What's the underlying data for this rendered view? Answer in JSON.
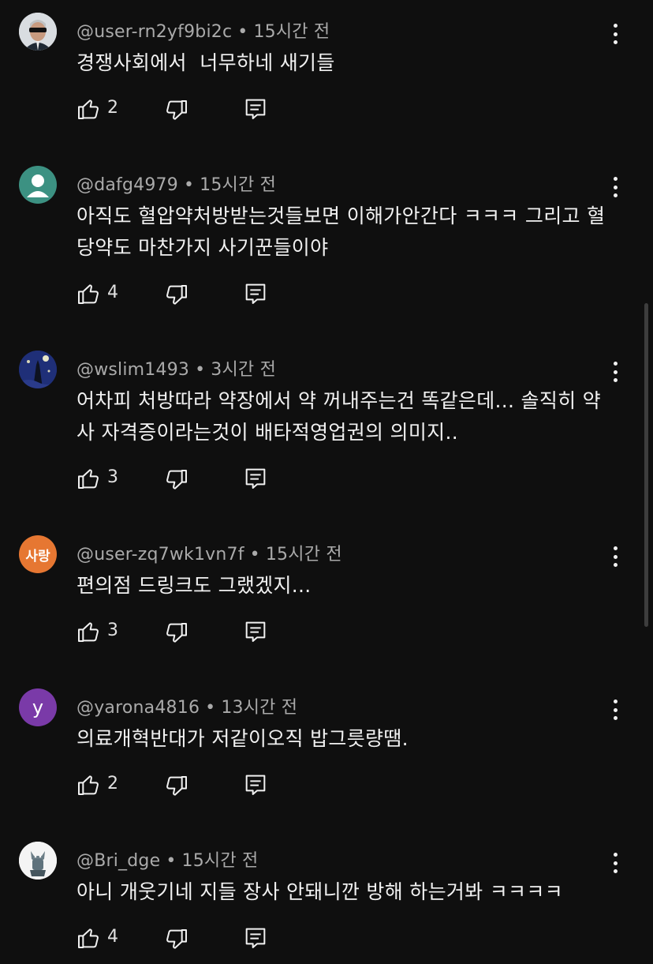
{
  "comments": [
    {
      "username": "@user-rn2yf9bi2c",
      "time": "15시간 전",
      "text": "경쟁사회에서  너무하네 새기들",
      "likes": "2",
      "avatar_type": "photo-man-sunglasses"
    },
    {
      "username": "@dafg4979",
      "time": "15시간 전",
      "text": "아직도 혈압약처방받는것들보면 이해가안간다 ㅋㅋㅋ 그리고 혈당약도 마찬가지 사기꾼들이야",
      "likes": "4",
      "avatar_type": "default-person",
      "avatar_color": "#3c9182"
    },
    {
      "username": "@wslim1493",
      "time": "3시간 전",
      "text": "어차피 처방따라 약장에서 약 꺼내주는건 똑같은데... 솔직히 약사 자격증이라는것이 배타적영업권의 의미지..",
      "likes": "3",
      "avatar_type": "photo-night-tower"
    },
    {
      "username": "@user-zq7wk1vn7f",
      "time": "15시간 전",
      "text": "편의점 드링크도 그랬겠지...",
      "likes": "3",
      "avatar_type": "text",
      "avatar_text": "사랑",
      "avatar_color": "#e67732"
    },
    {
      "username": "@yarona4816",
      "time": "13시간 전",
      "text": "의료개혁반대가 저같이오직 밥그릇량땜.",
      "likes": "2",
      "avatar_type": "letter",
      "avatar_text": "y",
      "avatar_color": "#7a3aa8"
    },
    {
      "username": "@Bri_dge",
      "time": "15시간 전",
      "text": "아니 개웃기네 지들 장사 안돼니깐 방해 하는거봐 ㅋㅋㅋㅋ",
      "likes": "4",
      "avatar_type": "photo-cartoon-wolf"
    }
  ],
  "icons": {
    "like": "thumbs-up-icon",
    "dislike": "thumbs-down-icon",
    "reply": "reply-icon",
    "more": "more-vertical-icon"
  },
  "separator": "•"
}
